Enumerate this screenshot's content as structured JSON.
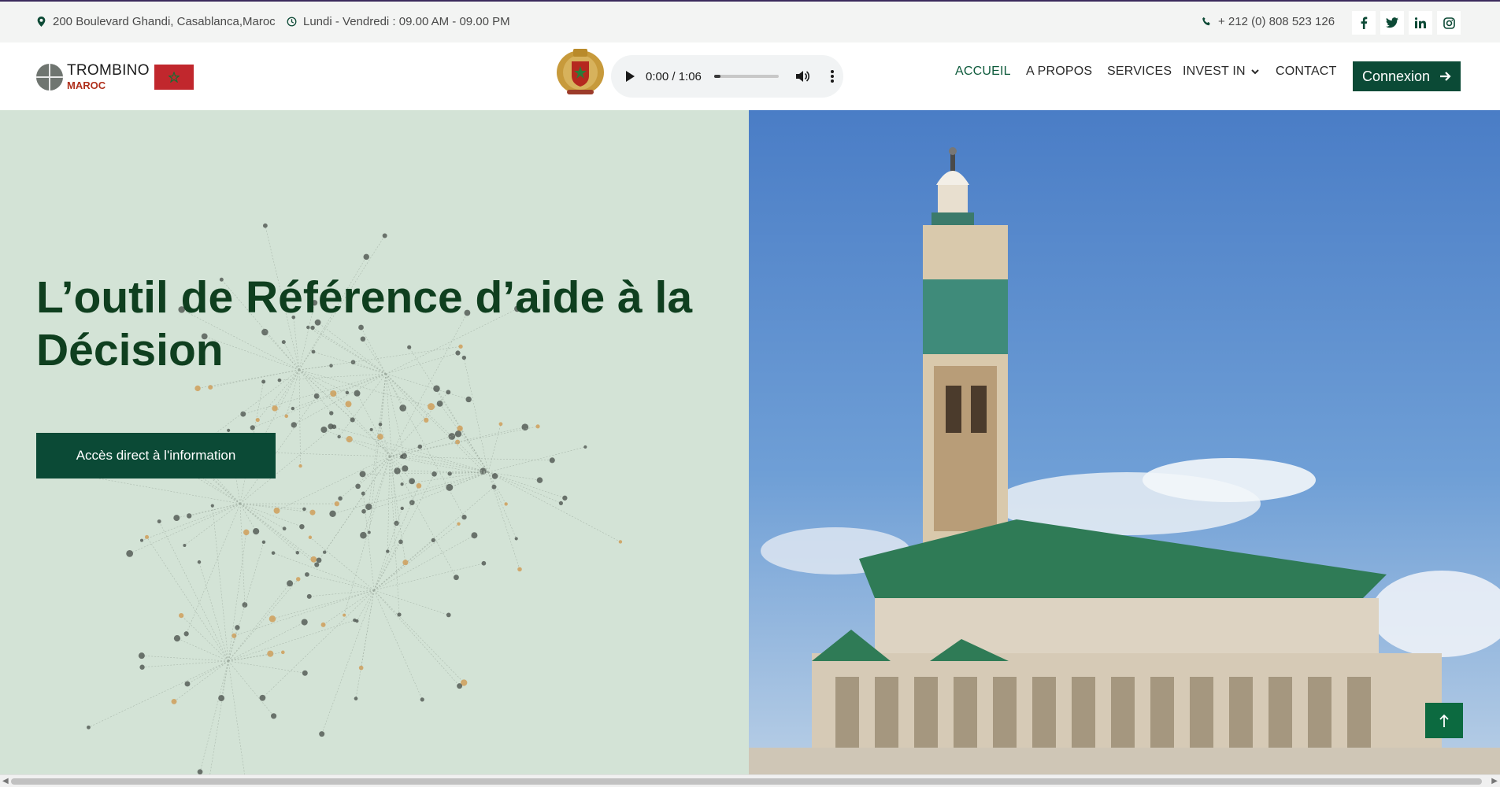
{
  "topbar": {
    "address": "200 Boulevard Ghandi, Casablanca,Maroc",
    "hours": "Lundi - Vendredi : 09.00 AM - 09.00 PM",
    "phone": "+ 212 (0) 808 523 126",
    "icons": [
      "map-pin-icon",
      "clock-icon",
      "phone-icon"
    ],
    "social": [
      "facebook-icon",
      "twitter-icon",
      "linkedin-icon",
      "instagram-icon"
    ]
  },
  "brand": {
    "title": "TROMBINO",
    "subtitle": "MAROC"
  },
  "audio": {
    "time": "0:00 / 1:06",
    "progress": 0
  },
  "nav": {
    "items": [
      {
        "label": "ACCUEIL",
        "active": true
      },
      {
        "label": "A PROPOS"
      },
      {
        "label": "SERVICES"
      },
      {
        "label": "INVEST IN"
      },
      {
        "label": "CONTACT"
      }
    ],
    "connexion_label": "Connexion"
  },
  "hero": {
    "headline_line1": "L’outil de Référence d’aide à la",
    "headline_line2": "Décision",
    "cta_label": "Accès direct à l'information"
  },
  "colors": {
    "brand_green": "#0b4a36",
    "hero_bg": "#d3e3d6",
    "headline": "#0f3f1f",
    "accent_red": "#c1272d"
  }
}
